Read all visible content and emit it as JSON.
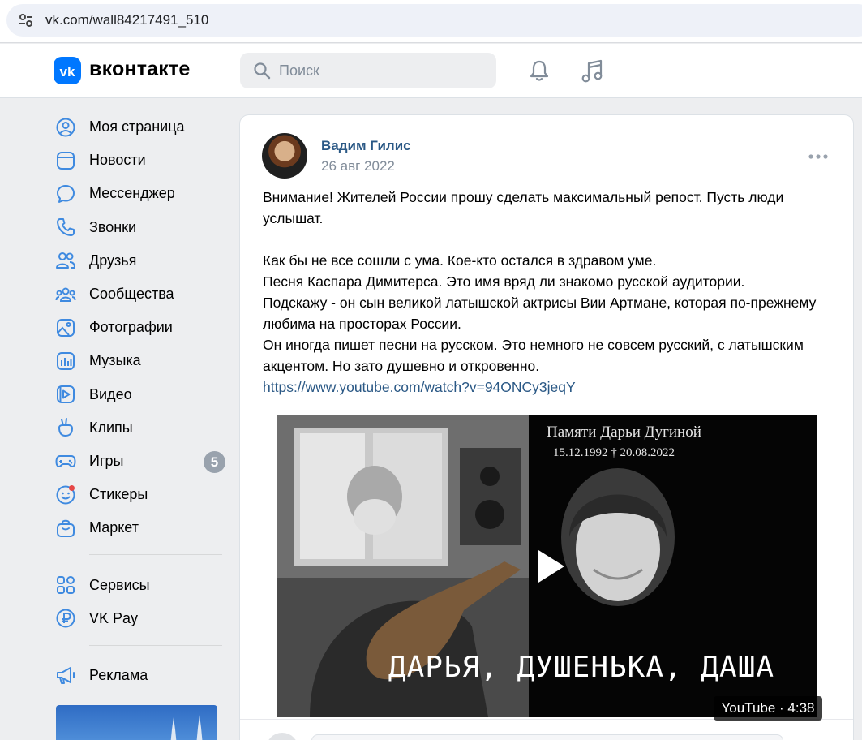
{
  "browser": {
    "url": "vk.com/wall84217491_510"
  },
  "header": {
    "logo_text": "вконтакте",
    "search_placeholder": "Поиск"
  },
  "sidebar": {
    "items": [
      {
        "label": "Моя страница",
        "icon": "profile-icon"
      },
      {
        "label": "Новости",
        "icon": "news-icon"
      },
      {
        "label": "Мессенджер",
        "icon": "messenger-icon"
      },
      {
        "label": "Звонки",
        "icon": "phone-icon"
      },
      {
        "label": "Друзья",
        "icon": "friends-icon"
      },
      {
        "label": "Сообщества",
        "icon": "communities-icon"
      },
      {
        "label": "Фотографии",
        "icon": "photos-icon"
      },
      {
        "label": "Музыка",
        "icon": "music-icon"
      },
      {
        "label": "Видео",
        "icon": "video-icon"
      },
      {
        "label": "Клипы",
        "icon": "clips-icon"
      },
      {
        "label": "Игры",
        "icon": "games-icon",
        "badge": "5"
      },
      {
        "label": "Стикеры",
        "icon": "stickers-icon"
      },
      {
        "label": "Маркет",
        "icon": "market-icon"
      }
    ],
    "secondary": [
      {
        "label": "Сервисы",
        "icon": "services-icon"
      },
      {
        "label": "VK Pay",
        "icon": "vkpay-icon"
      }
    ],
    "tertiary": [
      {
        "label": "Реклама",
        "icon": "ads-icon"
      }
    ]
  },
  "post": {
    "author": "Вадим Гилис",
    "date": "26 авг 2022",
    "paragraph1": "Внимание! Жителей России прошу сделать максимальный репост. Пусть люди услышат.",
    "line1": "Как бы не все сошли с ума. Кое-кто остался в здравом уме.",
    "line2": "Песня Каспара Димитерса. Это имя вряд ли знакомо русской аудитории.",
    "line3": "Подскажу - он сын великой латышской актрисы Вии Артмане, которая по-прежнему любима на просторах России.",
    "line4": "Он иногда пишет песни на русском. Это немного не совсем русский, с латышским акцентом. Но зато душевно и откровенно.",
    "link": "https://www.youtube.com/watch?v=94ONCy3jeqY"
  },
  "video": {
    "memorial_title": "Памяти Дарьи Дугиной",
    "memorial_dates": "15.12.1992 † 20.08.2022",
    "caption": "ДАРЬЯ, ДУШЕНЬКА, ДАША",
    "duration": "YouTube · 4:38"
  },
  "colors": {
    "accent": "#0077ff",
    "link": "#2a5885",
    "secondary_text": "#818c99",
    "badge": "#99a2ad"
  }
}
